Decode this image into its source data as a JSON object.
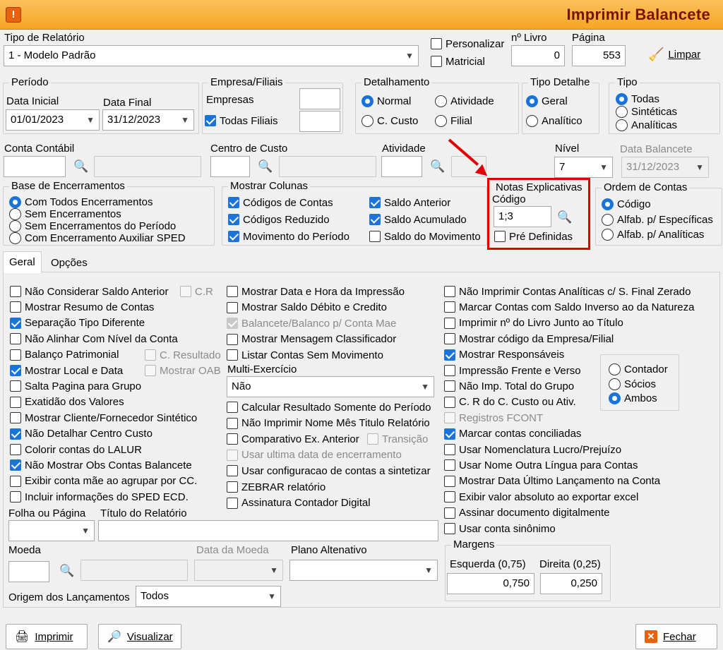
{
  "window": {
    "title": "Imprimir Balancete",
    "app_icon": "!"
  },
  "report_type": {
    "label": "Tipo de Relatório",
    "value": "1 - Modelo Padrão"
  },
  "personalizar": {
    "label": "Personalizar",
    "checked": false
  },
  "matricial": {
    "label": "Matricial",
    "checked": false
  },
  "livro": {
    "label": "nº Livro",
    "value": "0"
  },
  "pagina": {
    "label": "Página",
    "value": "553"
  },
  "limpar": {
    "label": "Limpar"
  },
  "periodo": {
    "title": "Período",
    "start_label": "Data Inicial",
    "start": "01/01/2023",
    "end_label": "Data Final",
    "end": "31/12/2023"
  },
  "empresa": {
    "title": "Empresa/Filiais",
    "empresas_label": "Empresas",
    "todas_label": "Todas Filiais",
    "todas_checked": true
  },
  "detalhamento": {
    "title": "Detalhamento",
    "options": [
      "Normal",
      "Atividade",
      "C. Custo",
      "Filial"
    ],
    "selected": "Normal"
  },
  "tipo_detalhe": {
    "title": "Tipo Detalhe",
    "options": [
      "Geral",
      "Analítico"
    ],
    "selected": "Geral"
  },
  "tipo": {
    "title": "Tipo",
    "options": [
      "Todas",
      "Sintéticas",
      "Analíticas"
    ],
    "selected": "Todas"
  },
  "conta_contabil": {
    "label": "Conta Contábil"
  },
  "centro_custo": {
    "label": "Centro de Custo"
  },
  "atividade": {
    "label": "Atividade"
  },
  "nivel": {
    "label": "Nível",
    "value": "7"
  },
  "data_balancete": {
    "label": "Data Balancete",
    "value": "31/12/2023"
  },
  "base_encerramentos": {
    "title": "Base de Encerramentos",
    "options": [
      "Com Todos Encerramentos",
      "Sem Encerramentos",
      "Sem Encerramentos do Período",
      "Com Encerramento Auxiliar SPED"
    ],
    "selected": "Com Todos Encerramentos"
  },
  "mostrar_colunas": {
    "title": "Mostrar Colunas",
    "items": [
      {
        "label": "Códigos de Contas",
        "checked": true
      },
      {
        "label": "Códigos Reduzido",
        "checked": true
      },
      {
        "label": "Movimento do Período",
        "checked": true
      },
      {
        "label": "Saldo Anterior",
        "checked": true
      },
      {
        "label": "Saldo Acumulado",
        "checked": true
      },
      {
        "label": "Saldo do Movimento",
        "checked": false
      }
    ]
  },
  "notas": {
    "title": "Notas Explicativas",
    "codigo_label": "Código",
    "codigo": "1;3",
    "pre_label": "Pré Definidas",
    "pre_checked": false
  },
  "ordem": {
    "title": "Ordem de Contas",
    "options": [
      "Código",
      "Alfab. p/  Específicas",
      "Alfab. p/ Analíticas"
    ],
    "selected": "Código"
  },
  "tabs": [
    "Geral",
    "Opções"
  ],
  "col1": [
    {
      "label": "Não Considerar Saldo Anterior",
      "checked": false
    },
    {
      "label": "Mostrar Resumo de Contas",
      "checked": false
    },
    {
      "label": "Separação Tipo Diferente",
      "checked": true
    },
    {
      "label": "Não Alinhar Com Nível da Conta",
      "checked": false
    },
    {
      "label": "Balanço Patrimonial",
      "checked": false
    },
    {
      "label": "Mostrar Local e Data",
      "checked": true
    },
    {
      "label": "Salta Pagina para Grupo",
      "checked": false
    },
    {
      "label": "Exatidão dos Valores",
      "checked": false
    },
    {
      "label": "Mostrar Cliente/Fornecedor Sintético",
      "checked": false
    },
    {
      "label": "Não Detalhar Centro Custo",
      "checked": true
    },
    {
      "label": "Colorir contas do LALUR",
      "checked": false
    },
    {
      "label": "Não Mostrar Obs Contas Balancete",
      "checked": true
    },
    {
      "label": "Exibir conta mãe ao agrupar por CC.",
      "checked": false
    },
    {
      "label": "Incluir informações do SPED ECD.",
      "checked": false
    }
  ],
  "col1_side": {
    "cr": "C.R",
    "c_resultado": "C. Resultado",
    "mostrar_oab": "Mostrar OAB"
  },
  "col2": [
    {
      "label": "Mostrar Data e Hora da Impressão",
      "checked": false,
      "disabled": false
    },
    {
      "label": "Mostrar Saldo Débito e Credito",
      "checked": false,
      "disabled": false
    },
    {
      "label": "Balancete/Balanco p/ Conta Mae",
      "checked": true,
      "disabled": true
    },
    {
      "label": "Mostrar Mensagem Classificador",
      "checked": false,
      "disabled": false
    },
    {
      "label": "Listar Contas Sem Movimento",
      "checked": false,
      "disabled": false
    }
  ],
  "multi": {
    "label": "Multi-Exercício",
    "value": "Não"
  },
  "col2b": [
    {
      "label": "Calcular Resultado Somente do Período",
      "checked": false,
      "disabled": false
    },
    {
      "label": "Não Imprimir Nome Mês Titulo Relatório",
      "checked": false,
      "disabled": false
    },
    {
      "label": "Comparativo Ex. Anterior",
      "checked": false,
      "disabled": false
    },
    {
      "label": "Usar ultima data de encerramento",
      "checked": false,
      "disabled": true
    },
    {
      "label": "Usar configuracao de contas a sintetizar",
      "checked": false,
      "disabled": false
    },
    {
      "label": "ZEBRAR relatório",
      "checked": false,
      "disabled": false
    },
    {
      "label": "Assinatura Contador Digital",
      "checked": false,
      "disabled": false
    }
  ],
  "transicao": "Transição",
  "col3": [
    {
      "label": "Não Imprimir Contas Analíticas c/ S. Final Zerado",
      "checked": false,
      "disabled": false
    },
    {
      "label": "Marcar Contas com Saldo Inverso ao da Natureza",
      "checked": false,
      "disabled": false
    },
    {
      "label": "Imprimir nº do Livro Junto ao Título",
      "checked": false,
      "disabled": false
    },
    {
      "label": "Mostrar código da Empresa/Filial",
      "checked": false,
      "disabled": false
    },
    {
      "label": "Mostrar Responsáveis",
      "checked": true,
      "disabled": false
    },
    {
      "label": "Impressão Frente e Verso",
      "checked": false,
      "disabled": false
    },
    {
      "label": "Não Imp. Total do Grupo",
      "checked": false,
      "disabled": false
    },
    {
      "label": "C. R do C. Custo ou Ativ.",
      "checked": false,
      "disabled": false
    },
    {
      "label": "Registros FCONT",
      "checked": false,
      "disabled": true
    },
    {
      "label": "Marcar contas conciliadas",
      "checked": true,
      "disabled": false
    },
    {
      "label": "Usar Nomenclatura Lucro/Prejuízo",
      "checked": false,
      "disabled": false
    },
    {
      "label": "Usar Nome Outra Língua para Contas",
      "checked": false,
      "disabled": false
    },
    {
      "label": "Mostrar Data Último Lançamento na Conta",
      "checked": false,
      "disabled": false
    },
    {
      "label": "Exibir valor absoluto ao exportar excel",
      "checked": false,
      "disabled": false
    },
    {
      "label": "Assinar documento digitalmente",
      "checked": false,
      "disabled": false
    },
    {
      "label": "Usar conta sinônimo",
      "checked": false,
      "disabled": false
    }
  ],
  "responsaveis": {
    "options": [
      "Contador",
      "Sócios",
      "Ambos"
    ],
    "selected": "Ambos"
  },
  "folha": {
    "label": "Folha ou Página"
  },
  "titulo": {
    "label": "Título do Relatório"
  },
  "moeda": {
    "label": "Moeda"
  },
  "data_moeda": {
    "label": "Data da Moeda"
  },
  "plano": {
    "label": "Plano Altenativo"
  },
  "origem": {
    "label": "Origem dos Lançamentos",
    "value": "Todos"
  },
  "margens": {
    "title": "Margens",
    "left_label": "Esquerda (0,75)",
    "left": "0,750",
    "right_label": "Direita (0,25)",
    "right": "0,250"
  },
  "buttons": {
    "imprimir": "Imprimir",
    "visualizar": "Visualizar",
    "fechar": "Fechar"
  },
  "colors": {
    "title_bar": "#f5a623",
    "title_text": "#7a1200",
    "accent": "#1a73d9",
    "highlight": "#e00000"
  }
}
